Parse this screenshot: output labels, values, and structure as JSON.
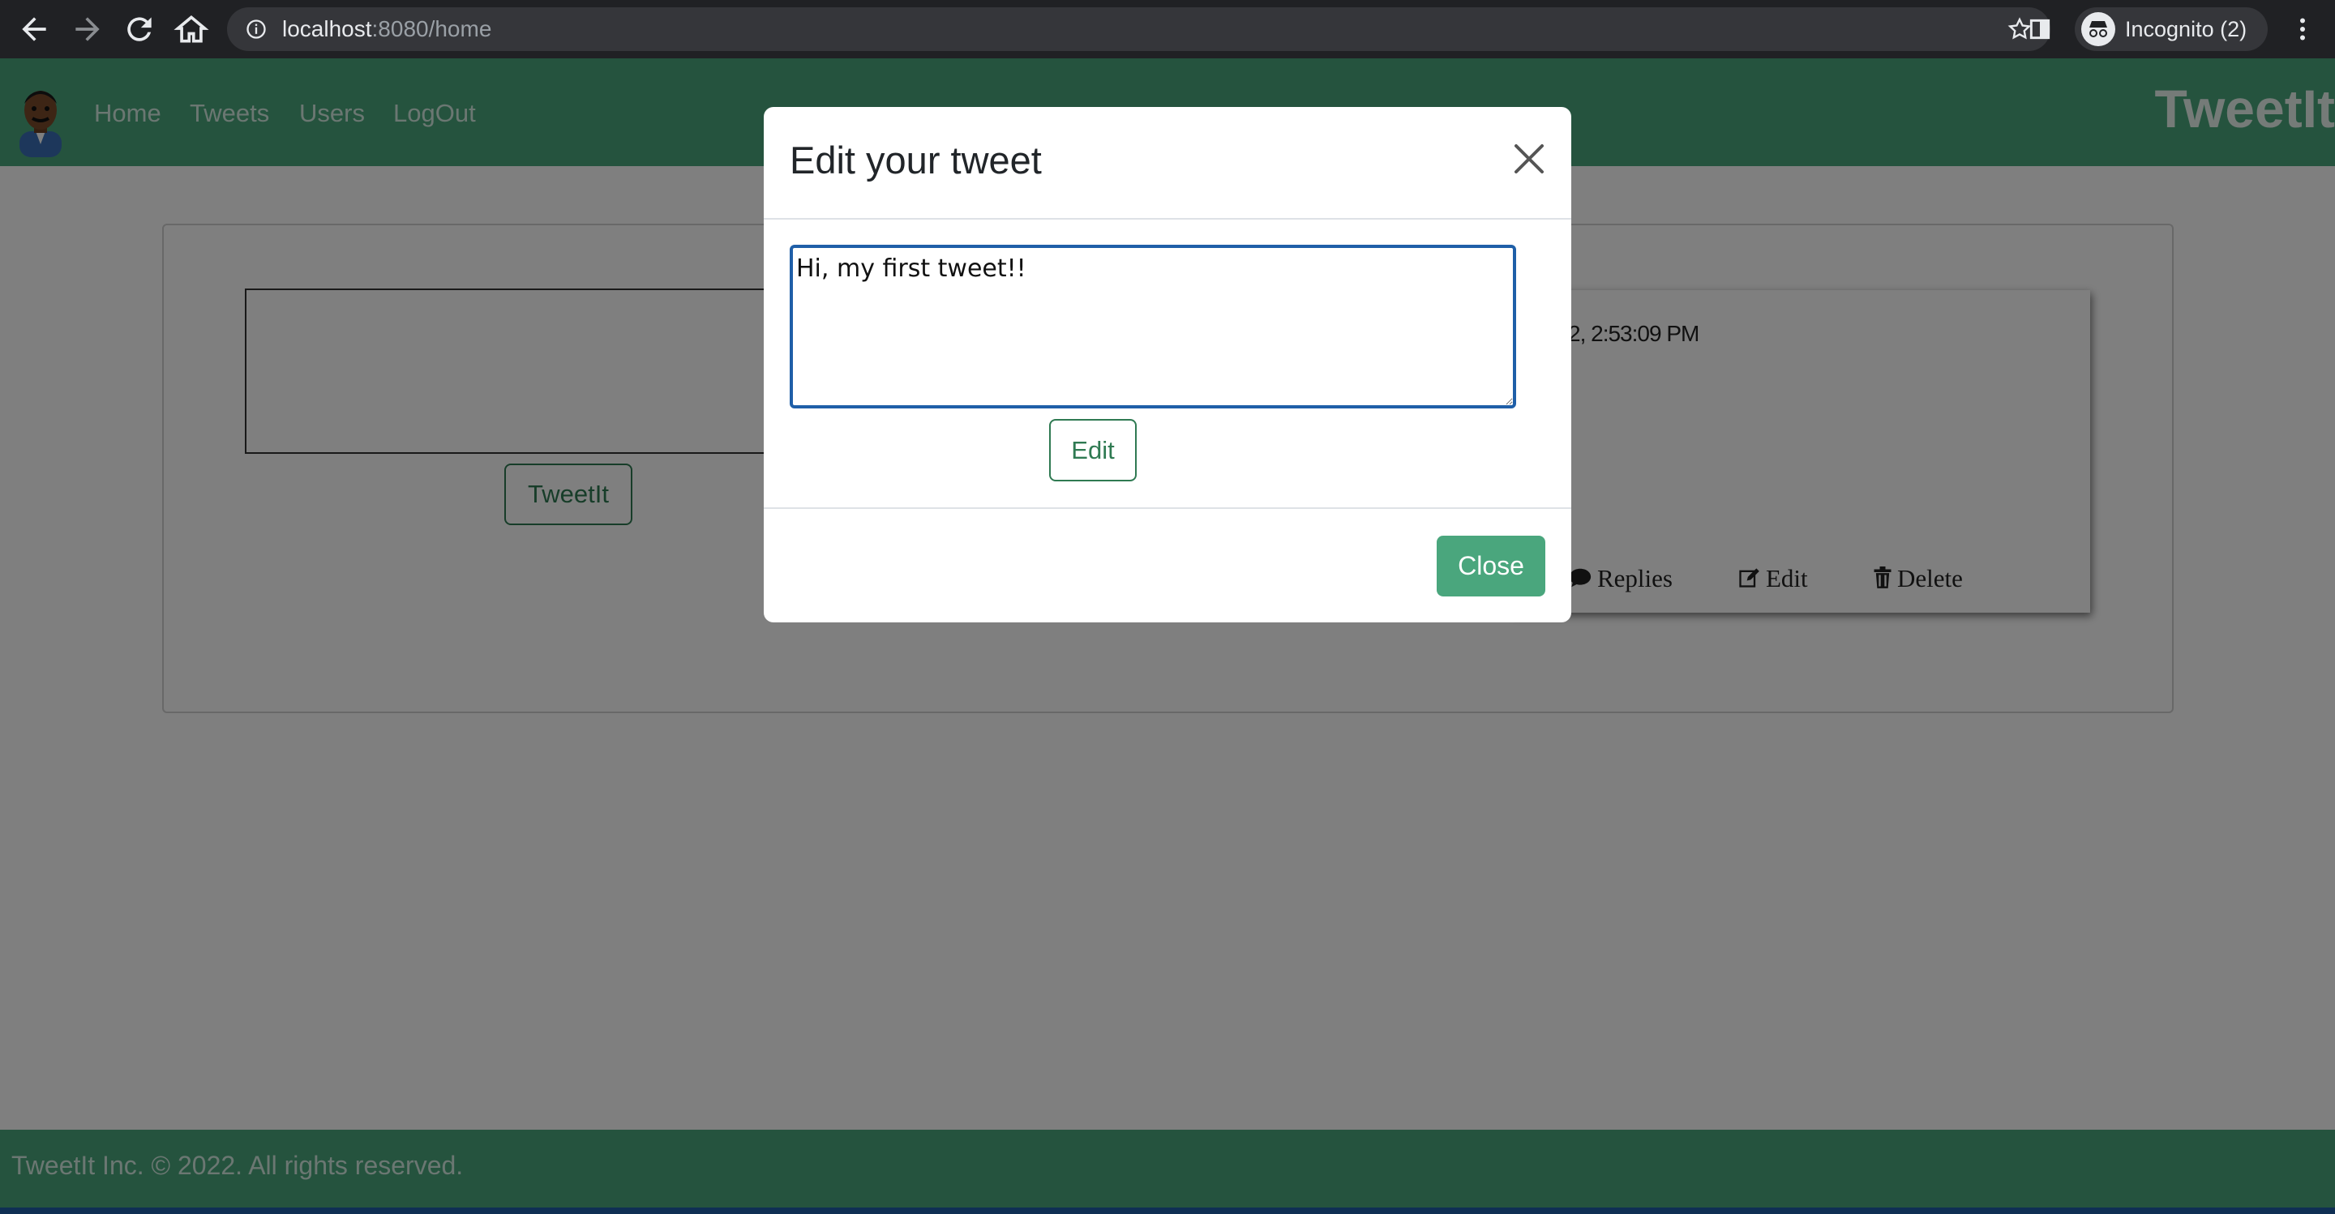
{
  "browser": {
    "url_host": "localhost",
    "url_path": ":8080/home",
    "profile_label": "Incognito (2)"
  },
  "navbar": {
    "links": [
      "Home",
      "Tweets",
      "Users",
      "LogOut"
    ],
    "brand": "TweetIt"
  },
  "composer": {
    "button_label": "TweetIt"
  },
  "tweet": {
    "timestamp_visible": "2, 2:53:09 PM",
    "actions": [
      "Replies",
      "Edit",
      "Delete"
    ]
  },
  "footer": {
    "text": "TweetIt Inc. © 2022. All rights reserved."
  },
  "modal": {
    "title": "Edit your tweet",
    "textarea_value": "Hi, my first tweet!!",
    "edit_button": "Edit",
    "close_button": "Close"
  },
  "colors": {
    "navbar": "#4aa67d",
    "button_outline": "#2f7a52",
    "focus_border": "#1f5fa8"
  }
}
